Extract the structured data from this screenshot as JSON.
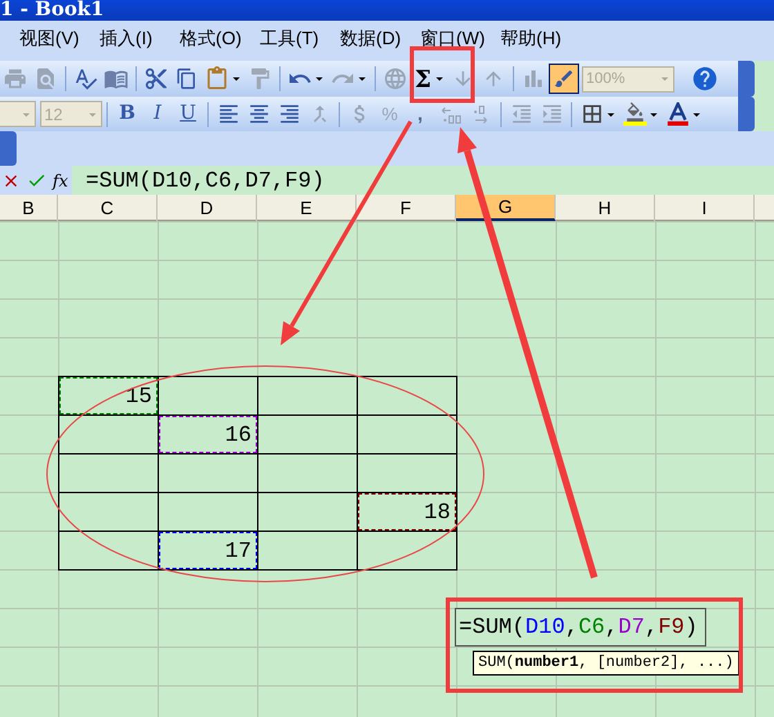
{
  "window": {
    "title": "1 - Book1"
  },
  "menu": [
    {
      "label": "视图(V)"
    },
    {
      "label": "插入(I)"
    },
    {
      "label": "格式(O)"
    },
    {
      "label": "工具(T)"
    },
    {
      "label": "数据(D)"
    },
    {
      "label": "窗口(W)"
    },
    {
      "label": "帮助(H)"
    }
  ],
  "standard_toolbar": {
    "autosum": "Σ",
    "zoom": "100%",
    "zoom_disabled": true,
    "drawing_active": true
  },
  "formatting_toolbar": {
    "font_size": "12",
    "bold": "B",
    "italic": "I",
    "underline": "U",
    "percent": "%",
    "comma": ","
  },
  "formula_bar": {
    "fx_label": "fx",
    "formula": "=SUM(D10,C6,D7,F9)"
  },
  "columns": [
    {
      "label": "B",
      "selected": false
    },
    {
      "label": "C",
      "selected": false
    },
    {
      "label": "D",
      "selected": false
    },
    {
      "label": "E",
      "selected": false
    },
    {
      "label": "F",
      "selected": false
    },
    {
      "label": "G",
      "selected": true
    },
    {
      "label": "H",
      "selected": false
    },
    {
      "label": "I",
      "selected": false
    }
  ],
  "table": {
    "rows": [
      [
        {
          "value": "15",
          "color": "#008000"
        },
        null,
        null,
        null
      ],
      [
        null,
        {
          "value": "16",
          "color": "#9900cc"
        },
        null,
        null
      ],
      [
        null,
        null,
        null,
        null
      ],
      [
        null,
        null,
        null,
        {
          "value": "18",
          "color": "#800000"
        }
      ],
      [
        null,
        {
          "value": "17",
          "color": "#0000ff"
        },
        null,
        null
      ]
    ]
  },
  "cell_editor": {
    "segments": [
      {
        "text": "=SUM(",
        "color": "#000000"
      },
      {
        "text": "D10",
        "color": "#0000ff"
      },
      {
        "text": ",",
        "color": "#000000"
      },
      {
        "text": "C6",
        "color": "#008000"
      },
      {
        "text": ",",
        "color": "#000000"
      },
      {
        "text": "D7",
        "color": "#9900cc"
      },
      {
        "text": ",",
        "color": "#000000"
      },
      {
        "text": "F9",
        "color": "#800000"
      },
      {
        "text": ")",
        "color": "#000000"
      }
    ]
  },
  "tooltip": "SUM(**number1**, [number2], ...)"
}
